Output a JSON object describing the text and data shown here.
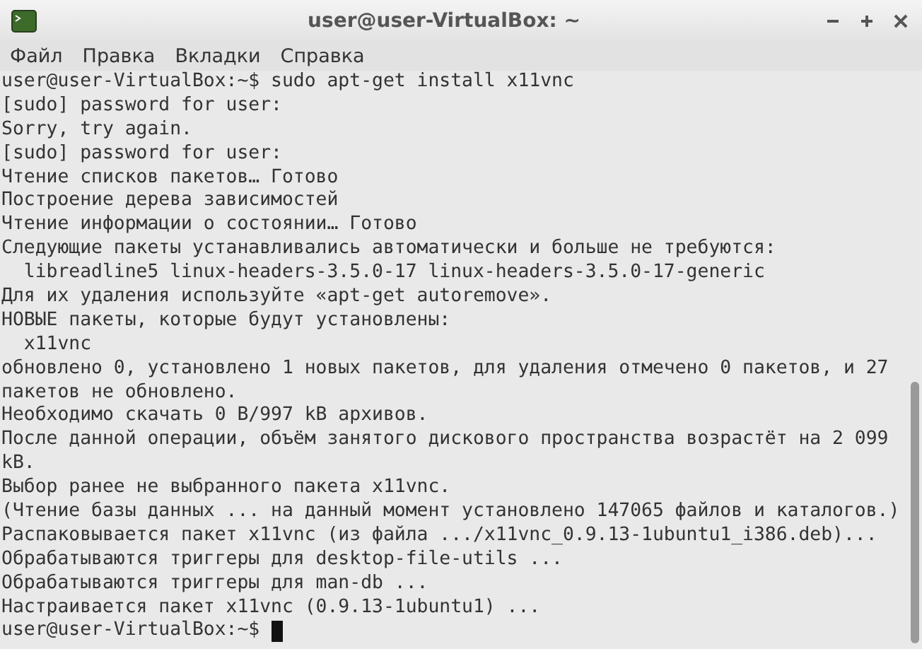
{
  "window": {
    "title": "user@user-VirtualBox: ~"
  },
  "menu": [
    "Файл",
    "Правка",
    "Вкладки",
    "Справка"
  ],
  "terminal": {
    "lines": [
      "user@user-VirtualBox:~$ sudo apt-get install x11vnc",
      "[sudo] password for user:",
      "Sorry, try again.",
      "[sudo] password for user:",
      "Чтение списков пакетов… Готово",
      "Построение дерева зависимостей",
      "Чтение информации о состоянии… Готово",
      "Следующие пакеты устанавливались автоматически и больше не требуются:",
      "  libreadline5 linux-headers-3.5.0-17 linux-headers-3.5.0-17-generic",
      "Для их удаления используйте «apt-get autoremove».",
      "НОВЫЕ пакеты, которые будут установлены:",
      "  x11vnc",
      "обновлено 0, установлено 1 новых пакетов, для удаления отмечено 0 пакетов, и 27",
      "пакетов не обновлено.",
      "Необходимо скачать 0 B/997 kB архивов.",
      "После данной операции, объём занятого дискового пространства возрастёт на 2 099",
      "kB.",
      "Выбор ранее не выбранного пакета x11vnc.",
      "(Чтение базы данных ... на данный момент установлено 147065 файлов и каталогов.)",
      "Распаковывается пакет x11vnc (из файла .../x11vnc_0.9.13-1ubuntu1_i386.deb)...",
      "Обрабатываются триггеры для desktop-file-utils ...",
      "Обрабатываются триггеры для man-db ...",
      "Настраивается пакет x11vnc (0.9.13-1ubuntu1) ..."
    ],
    "prompt": "user@user-VirtualBox:~$"
  }
}
